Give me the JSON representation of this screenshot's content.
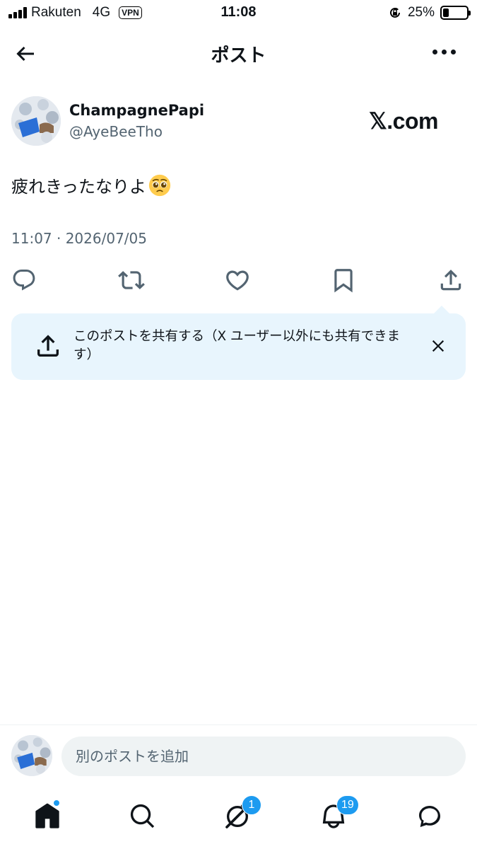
{
  "status_bar": {
    "carrier": "Rakuten",
    "network": "4G",
    "vpn": "VPN",
    "time": "11:08",
    "battery_percent": "25%",
    "battery_level": 0.25
  },
  "header": {
    "title": "ポスト"
  },
  "post": {
    "display_name": "ChampagnePapi",
    "handle": "@AyeBeeTho",
    "watermark": "𝕏.com",
    "text": "疲れきったなりよ",
    "timestamp": "11:07 · 2026/07/05"
  },
  "share_tip": {
    "text": "このポストを共有する（X ユーザー以外にも共有できます）"
  },
  "compose": {
    "placeholder": "別のポストを追加"
  },
  "tabbar": {
    "messages_badge": "1",
    "notifications_badge": "19"
  },
  "icons": {
    "back": "arrow-left-icon",
    "more": "more-icon",
    "reply": "reply-icon",
    "repost": "repost-icon",
    "like": "heart-icon",
    "bookmark": "bookmark-icon",
    "share": "share-icon",
    "close": "close-icon",
    "home": "home-icon",
    "search": "search-icon",
    "grok": "grok-icon",
    "notifications": "bell-icon",
    "messages": "messages-icon"
  },
  "colors": {
    "accent": "#1d9bf0",
    "text_primary": "#0f1419",
    "text_secondary": "#536471",
    "tip_background": "#e8f5fd"
  }
}
